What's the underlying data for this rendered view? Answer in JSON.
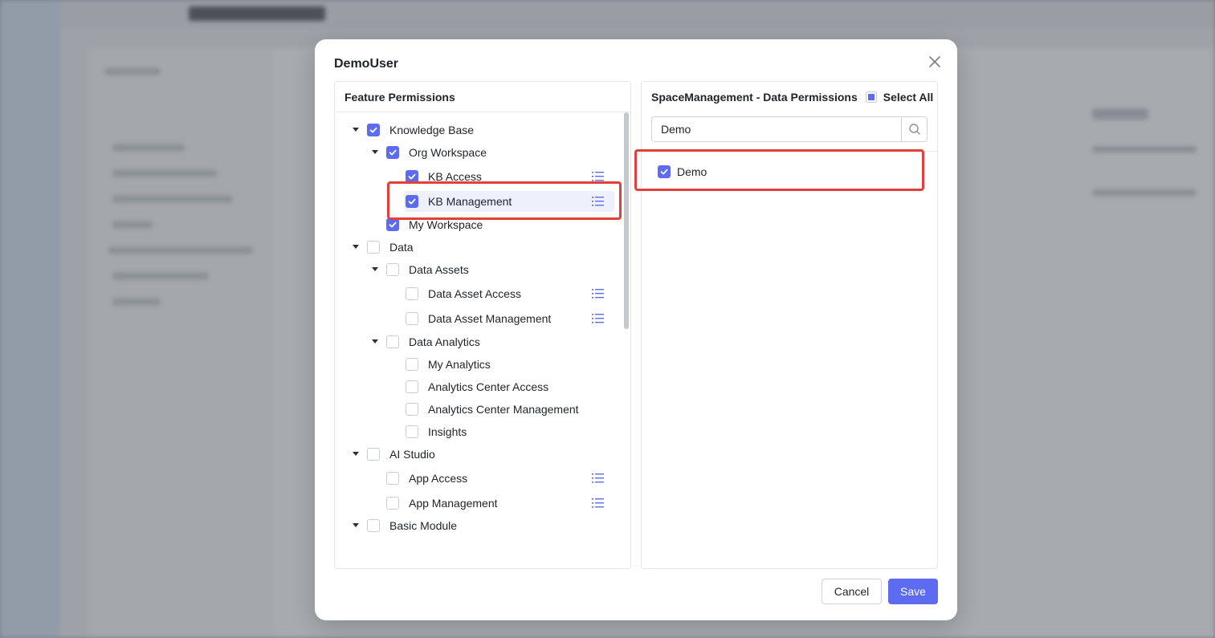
{
  "dialog": {
    "title": "DemoUser",
    "close_icon": "close-icon"
  },
  "feature_permissions": {
    "header": "Feature Permissions",
    "items": [
      {
        "label": "Knowledge Base",
        "level": 0,
        "expanded": true,
        "checked": true,
        "has_list_icon": false
      },
      {
        "label": "Org Workspace",
        "level": 1,
        "expanded": true,
        "checked": true,
        "has_list_icon": false
      },
      {
        "label": "KB Access",
        "level": 2,
        "checked": true,
        "has_list_icon": true
      },
      {
        "label": "KB Management",
        "level": 2,
        "checked": true,
        "has_list_icon": true,
        "selected": true
      },
      {
        "label": "My Workspace",
        "level": 1,
        "checked": true,
        "has_list_icon": false
      },
      {
        "label": "Data",
        "level": 0,
        "expanded": true,
        "checked": false,
        "has_list_icon": false
      },
      {
        "label": "Data Assets",
        "level": 1,
        "expanded": true,
        "checked": false,
        "has_list_icon": false
      },
      {
        "label": "Data Asset Access",
        "level": 2,
        "checked": false,
        "has_list_icon": true
      },
      {
        "label": "Data Asset Management",
        "level": 2,
        "checked": false,
        "has_list_icon": true
      },
      {
        "label": "Data Analytics",
        "level": 1,
        "expanded": true,
        "checked": false,
        "has_list_icon": false
      },
      {
        "label": "My Analytics",
        "level": 2,
        "checked": false,
        "has_list_icon": false
      },
      {
        "label": "Analytics Center Access",
        "level": 2,
        "checked": false,
        "has_list_icon": false
      },
      {
        "label": "Analytics Center Management",
        "level": 2,
        "checked": false,
        "has_list_icon": false
      },
      {
        "label": "Insights",
        "level": 2,
        "checked": false,
        "has_list_icon": false
      },
      {
        "label": "AI Studio",
        "level": 0,
        "expanded": true,
        "checked": false,
        "has_list_icon": false
      },
      {
        "label": "App Access",
        "level": 1,
        "checked": false,
        "has_list_icon": true
      },
      {
        "label": "App Management",
        "level": 1,
        "checked": false,
        "has_list_icon": true
      },
      {
        "label": "Basic Module",
        "level": 0,
        "expanded": true,
        "checked": false,
        "has_list_icon": false
      }
    ]
  },
  "data_permissions": {
    "header": "SpaceManagement - Data Permissions",
    "select_all_label": "Select All",
    "select_all_state": "partial",
    "search": {
      "value": "Demo",
      "placeholder": ""
    },
    "results": [
      {
        "label": "Demo",
        "checked": true
      }
    ]
  },
  "footer": {
    "cancel_label": "Cancel",
    "save_label": "Save"
  },
  "colors": {
    "accent": "#5c6bf0",
    "annotation_red": "#e1403b"
  }
}
